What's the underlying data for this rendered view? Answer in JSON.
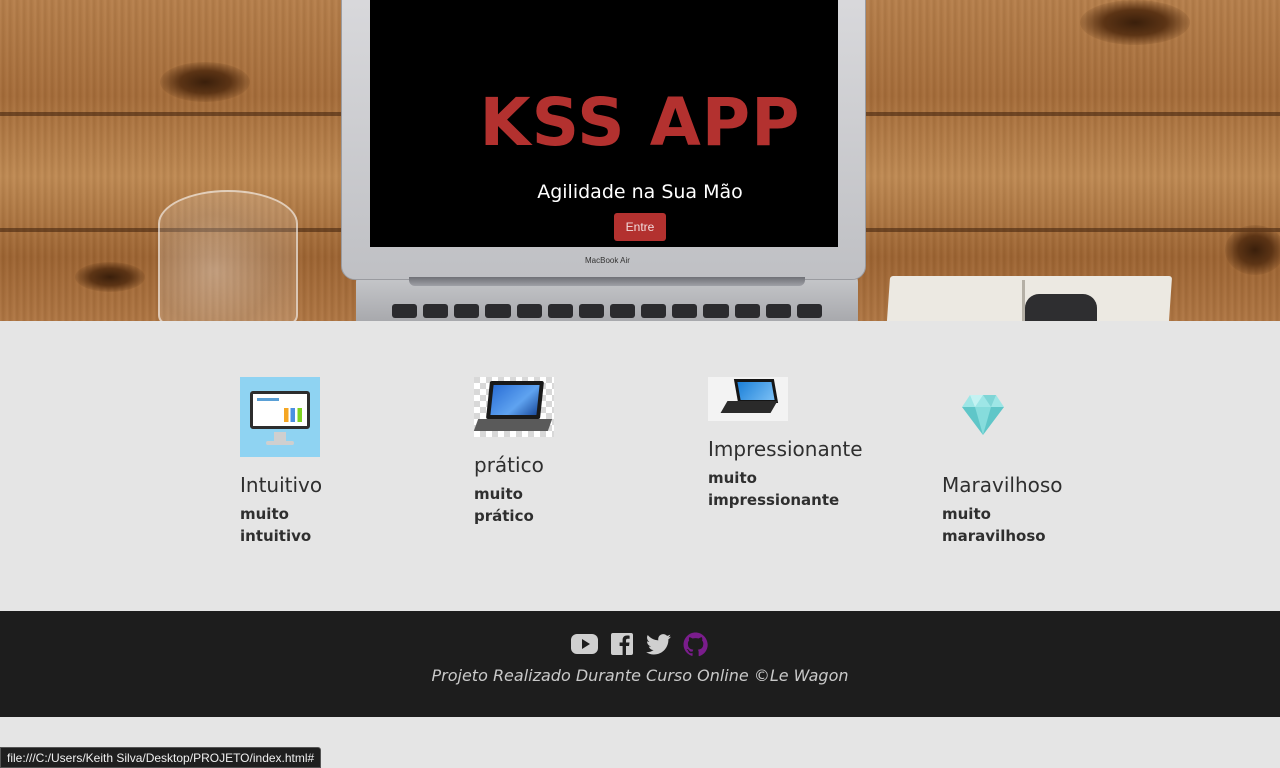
{
  "hero": {
    "title": "KSS APP",
    "subtitle": "Agilidade na Sua Mão",
    "button_label": "Entre",
    "laptop_brand": "MacBook Air",
    "accent_color": "#b3312f"
  },
  "features": [
    {
      "icon": "monitor-icon",
      "title": "Intuitivo",
      "description": "muito intuitivo"
    },
    {
      "icon": "laptop-icon",
      "title": "prático",
      "description": "muito prático"
    },
    {
      "icon": "laptop-icon",
      "title": "Impressionante",
      "description": "muito impressionante"
    },
    {
      "icon": "diamond-icon",
      "title": "Maravilhoso",
      "description": "muito maravilhoso"
    }
  ],
  "footer": {
    "socials": [
      {
        "name": "youtube-icon",
        "color": "#cfcfcf"
      },
      {
        "name": "facebook-icon",
        "color": "#cfcfcf"
      },
      {
        "name": "twitter-icon",
        "color": "#cfcfcf"
      },
      {
        "name": "github-icon",
        "color": "#7a1d8c"
      }
    ],
    "text": "Projeto Realizado Durante Curso Online ©Le Wagon"
  },
  "status_bar": {
    "url": "file:///C:/Users/Keith Silva/Desktop/PROJETO/index.html#"
  }
}
